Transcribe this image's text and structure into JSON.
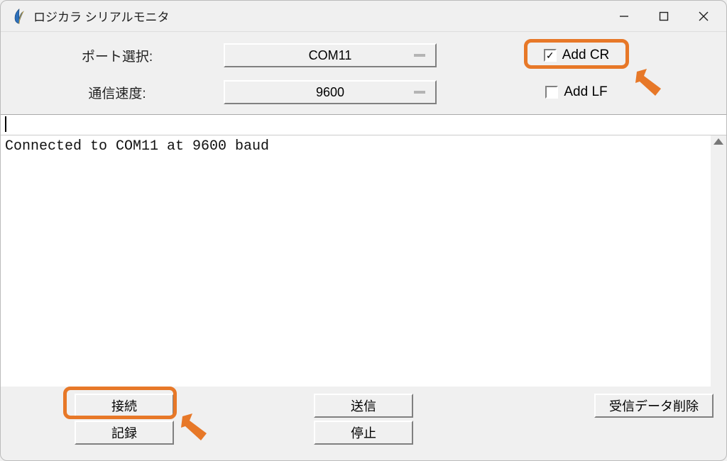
{
  "window": {
    "title": "ロジカラ シリアルモニタ"
  },
  "config": {
    "port_label": "ポート選択:",
    "port_value": "COM11",
    "baud_label": "通信速度:",
    "baud_value": "9600",
    "add_cr_label": "Add CR",
    "add_cr_checked": "✓",
    "add_lf_label": "Add LF"
  },
  "input": {
    "value": ""
  },
  "output": {
    "text": "Connected to COM11 at 9600 baud"
  },
  "buttons": {
    "connect": "接続",
    "send": "送信",
    "clear_rx": "受信データ削除",
    "record": "記録",
    "stop": "停止"
  },
  "annotations": {
    "highlight_add_cr": true,
    "highlight_connect": true
  }
}
